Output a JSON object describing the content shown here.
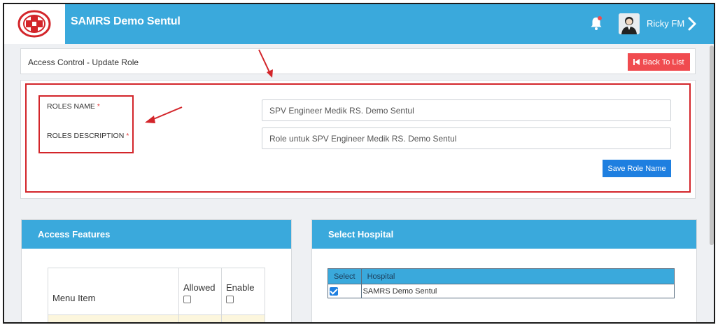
{
  "header": {
    "app_title": "SAMRS Demo Sentul",
    "user_name": "Ricky FM",
    "notification_dot_color": "#f04b4f"
  },
  "page": {
    "breadcrumb": "Access Control - Update Role",
    "back_button_label": "Back To List"
  },
  "form": {
    "roles_name_label": "ROLES NAME",
    "roles_description_label": "ROLES DESCRIPTION",
    "required_marker": "*",
    "roles_name_value": "SPV Engineer Medik RS. Demo Sentul",
    "roles_description_value": "Role untuk SPV Engineer Medik RS. Demo Sentul",
    "save_button_label": "Save Role Name"
  },
  "access_features": {
    "title": "Access Features",
    "columns": {
      "menu_item": "Menu Item",
      "allowed": "Allowed",
      "enable": "Enable"
    }
  },
  "select_hospital": {
    "title": "Select Hospital",
    "columns": {
      "select": "Select",
      "hospital": "Hospital"
    },
    "rows": [
      {
        "selected": true,
        "hospital": "SAMRS Demo Sentul"
      }
    ]
  },
  "colors": {
    "brand_blue": "#3aa9dc",
    "danger_red": "#f04b4f",
    "primary_blue": "#1e7fe0",
    "annotation_red": "#d3252a"
  }
}
